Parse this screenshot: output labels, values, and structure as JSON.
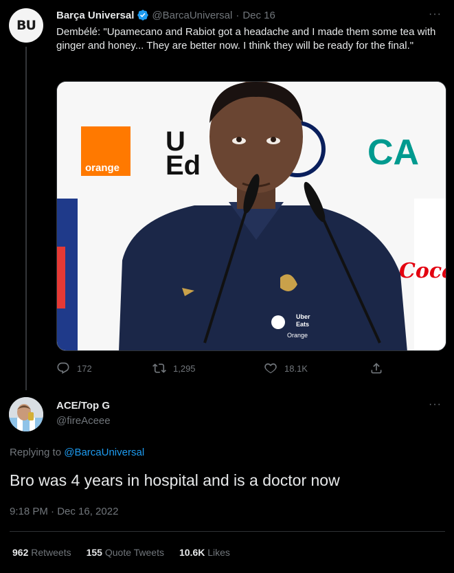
{
  "parent_tweet": {
    "avatar_text": "BU",
    "author_name": "Barça Universal",
    "handle": "@BarcaUniversal",
    "separator": "·",
    "date": "Dec 16",
    "more_label": "···",
    "text": "Dembélé: \"Upamecano and Rabiot got a headache and I made them some tea with ginger and honey... They are better now. I think they will be ready for the final.\"",
    "media": {
      "orange_logo_text": "orange",
      "ue_text_top": "U",
      "ue_text_bottom": "Ed",
      "ca_logo_text": "CA",
      "coca_cola_text": "Coca",
      "shirt_text_1": "Uber",
      "shirt_text_2": "Eats",
      "shirt_text_3": "Orange"
    },
    "actions": {
      "replies": "172",
      "retweets": "1,295",
      "likes": "18.1K"
    }
  },
  "reply_tweet": {
    "author_name": "ACE/Top G",
    "handle": "@fireAceee",
    "more_label": "···",
    "replying_prefix": "Replying to",
    "replying_handle": "@BarcaUniversal",
    "text": "Bro was 4 years in hospital and is a doctor now",
    "timestamp": "9:18 PM · Dec 16, 2022",
    "stats": {
      "retweets_count": "962",
      "retweets_label": "Retweets",
      "quotes_count": "155",
      "quotes_label": "Quote Tweets",
      "likes_count": "10.6K",
      "likes_label": "Likes"
    }
  },
  "colors": {
    "background": "#000000",
    "text": "#e7e9ea",
    "muted": "#71767b",
    "link": "#1d9bf0",
    "verified": "#1d9bf0",
    "divider": "#2f3336"
  },
  "icons": [
    "verified-icon",
    "reply-icon",
    "retweet-icon",
    "like-icon",
    "share-icon",
    "more-icon"
  ]
}
